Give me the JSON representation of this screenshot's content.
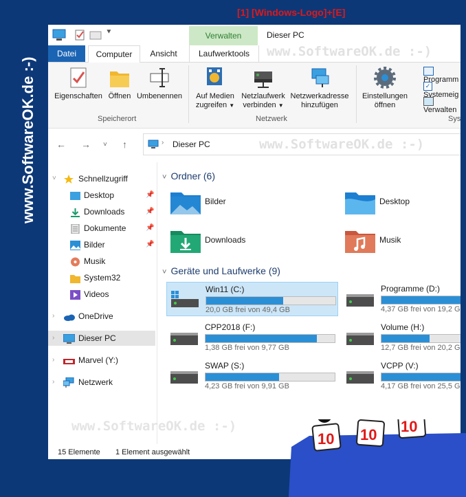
{
  "watermark": {
    "side": "www.SoftwareOK.de :-)",
    "ribbon": "www.SoftwareOK.de :-)",
    "address": "www.SoftwareOK.de :-)",
    "bottom": "www.SoftwareOK.de :-)"
  },
  "annotation": {
    "prefix": "[1]",
    "shortcut": "[Windows-Logo]+[E]"
  },
  "window": {
    "title": "Dieser PC",
    "context_tab": "Verwalten"
  },
  "tabs": {
    "file": "Datei",
    "computer": "Computer",
    "view": "Ansicht",
    "drive_tools": "Laufwerktools"
  },
  "ribbon": {
    "properties": "Eigenschaften",
    "open": "Öffnen",
    "rename": "Umbenennen",
    "group_location": "Speicherort",
    "media_line1": "Auf Medien",
    "media_line2": "zugreifen",
    "map_line1": "Netzlaufwerk",
    "map_line2": "verbinden",
    "addnet_line1": "Netzwerkadresse",
    "addnet_line2": "hinzufügen",
    "group_network": "Netzwerk",
    "settings_line1": "Einstellungen",
    "settings_line2": "öffnen",
    "programs": "Programm",
    "system_props": "Systemeig",
    "manage": "Verwalten",
    "group_system": "Syst"
  },
  "address": {
    "path": "Dieser PC"
  },
  "nav": {
    "quick_access": "Schnellzugriff",
    "items": [
      "Desktop",
      "Downloads",
      "Dokumente",
      "Bilder",
      "Musik",
      "System32",
      "Videos"
    ],
    "onedrive": "OneDrive",
    "this_pc": "Dieser PC",
    "marvel": "Marvel (Y:)",
    "network": "Netzwerk"
  },
  "folders": {
    "header": "Ordner (6)",
    "items": [
      "Bilder",
      "Desktop",
      "Downloads",
      "Musik"
    ]
  },
  "drives": {
    "header": "Geräte und Laufwerke (9)",
    "items": [
      {
        "name": "Win11 (C:)",
        "free": "20,0 GB frei von 49,4 GB",
        "used": 0.595
      },
      {
        "name": "Programme (D:)",
        "free": "4,37 GB frei von 19,2 G",
        "used": 0.77
      },
      {
        "name": "CPP2018 (F:)",
        "free": "1,38 GB frei von 9,77 GB",
        "used": 0.86
      },
      {
        "name": "Volume (H:)",
        "free": "12,7 GB frei von 20,2 G",
        "used": 0.37
      },
      {
        "name": "SWAP (S:)",
        "free": "4,23 GB frei von 9,91 GB",
        "used": 0.57
      },
      {
        "name": "VCPP (V:)",
        "free": "4,17 GB frei von 25,5 G",
        "used": 0.84
      }
    ]
  },
  "status": {
    "count": "15 Elemente",
    "selection": "1 Element ausgewählt"
  },
  "mascot": {
    "score": "10"
  },
  "colors": {
    "background": "#0d3878",
    "accent": "#1b64b4",
    "annotation": "#e01818",
    "bar_fill": "#2b8fd6"
  }
}
